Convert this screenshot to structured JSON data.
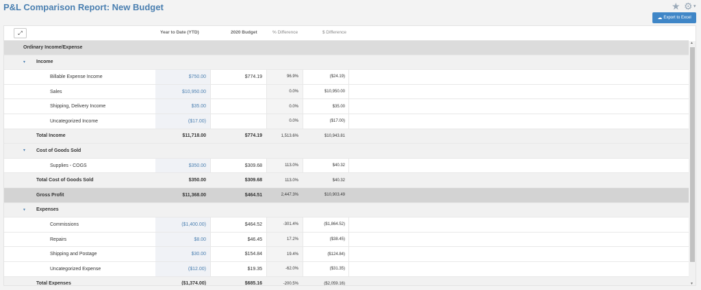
{
  "header": {
    "title": "P&L Comparison Report: New Budget",
    "export_label": "Export to Excel",
    "star_glyph": "★",
    "gear_glyph": "⚙",
    "caret_glyph": "▾",
    "cloud_glyph": "☁"
  },
  "columns": {
    "expand_glyph": "⤢",
    "ytd": "Year to Date (YTD)",
    "budget": "2020 Budget",
    "pct": "% Difference",
    "diff": "$ Difference"
  },
  "rows": [
    {
      "type": "section",
      "label": "Ordinary Income/Expense",
      "ytd": "",
      "budget": "",
      "pct": "",
      "diff": ""
    },
    {
      "type": "group",
      "label": "Income",
      "ytd": "",
      "budget": "",
      "pct": "",
      "diff": ""
    },
    {
      "type": "detail",
      "label": "Billable Expense Income",
      "ytd": "$750.00",
      "budget": "$774.19",
      "pct": "96.9%",
      "diff": "($24.19)"
    },
    {
      "type": "detail",
      "label": "Sales",
      "ytd": "$10,950.00",
      "budget": "",
      "pct": "0.0%",
      "diff": "$10,950.00"
    },
    {
      "type": "detail",
      "label": "Shipping, Delivery Income",
      "ytd": "$35.00",
      "budget": "",
      "pct": "0.0%",
      "diff": "$35.00"
    },
    {
      "type": "detail",
      "label": "Uncategorized Income",
      "ytd": "($17.00)",
      "budget": "",
      "pct": "0.0%",
      "diff": "($17.00)"
    },
    {
      "type": "total",
      "label": "Total Income",
      "ytd": "$11,718.00",
      "budget": "$774.19",
      "pct": "1,513.6%",
      "diff": "$10,943.81"
    },
    {
      "type": "group",
      "label": "Cost of Goods Sold",
      "ytd": "",
      "budget": "",
      "pct": "",
      "diff": ""
    },
    {
      "type": "detail",
      "label": "Supplies - COGS",
      "ytd": "$350.00",
      "budget": "$309.68",
      "pct": "113.0%",
      "diff": "$40.32"
    },
    {
      "type": "total",
      "label": "Total Cost of Goods Sold",
      "ytd": "$350.00",
      "budget": "$309.68",
      "pct": "113.0%",
      "diff": "$40.32"
    },
    {
      "type": "gross",
      "label": "Gross Profit",
      "ytd": "$11,368.00",
      "budget": "$464.51",
      "pct": "2,447.3%",
      "diff": "$10,903.49"
    },
    {
      "type": "group",
      "label": "Expenses",
      "ytd": "",
      "budget": "",
      "pct": "",
      "diff": ""
    },
    {
      "type": "detail",
      "label": "Commissions",
      "ytd": "($1,400.00)",
      "budget": "$464.52",
      "pct": "-301.4%",
      "diff": "($1,864.52)"
    },
    {
      "type": "detail",
      "label": "Repairs",
      "ytd": "$8.00",
      "budget": "$46.45",
      "pct": "17.2%",
      "diff": "($38.45)"
    },
    {
      "type": "detail",
      "label": "Shipping and Postage",
      "ytd": "$30.00",
      "budget": "$154.84",
      "pct": "19.4%",
      "diff": "($124.84)"
    },
    {
      "type": "detail",
      "label": "Uncategorized Expense",
      "ytd": "($12.00)",
      "budget": "$19.35",
      "pct": "-62.0%",
      "diff": "($31.35)"
    },
    {
      "type": "total",
      "label": "Total Expenses",
      "ytd": "($1,374.00)",
      "budget": "$685.16",
      "pct": "-200.5%",
      "diff": "($2,059.16)"
    }
  ],
  "scrollbar": {
    "up_glyph": "▲",
    "down_glyph": "▼"
  },
  "colors": {
    "accent": "#4a7fb0",
    "button": "#3f86c7",
    "section_bg": "#dcdcdc",
    "gross_bg": "#d3d3d3"
  }
}
